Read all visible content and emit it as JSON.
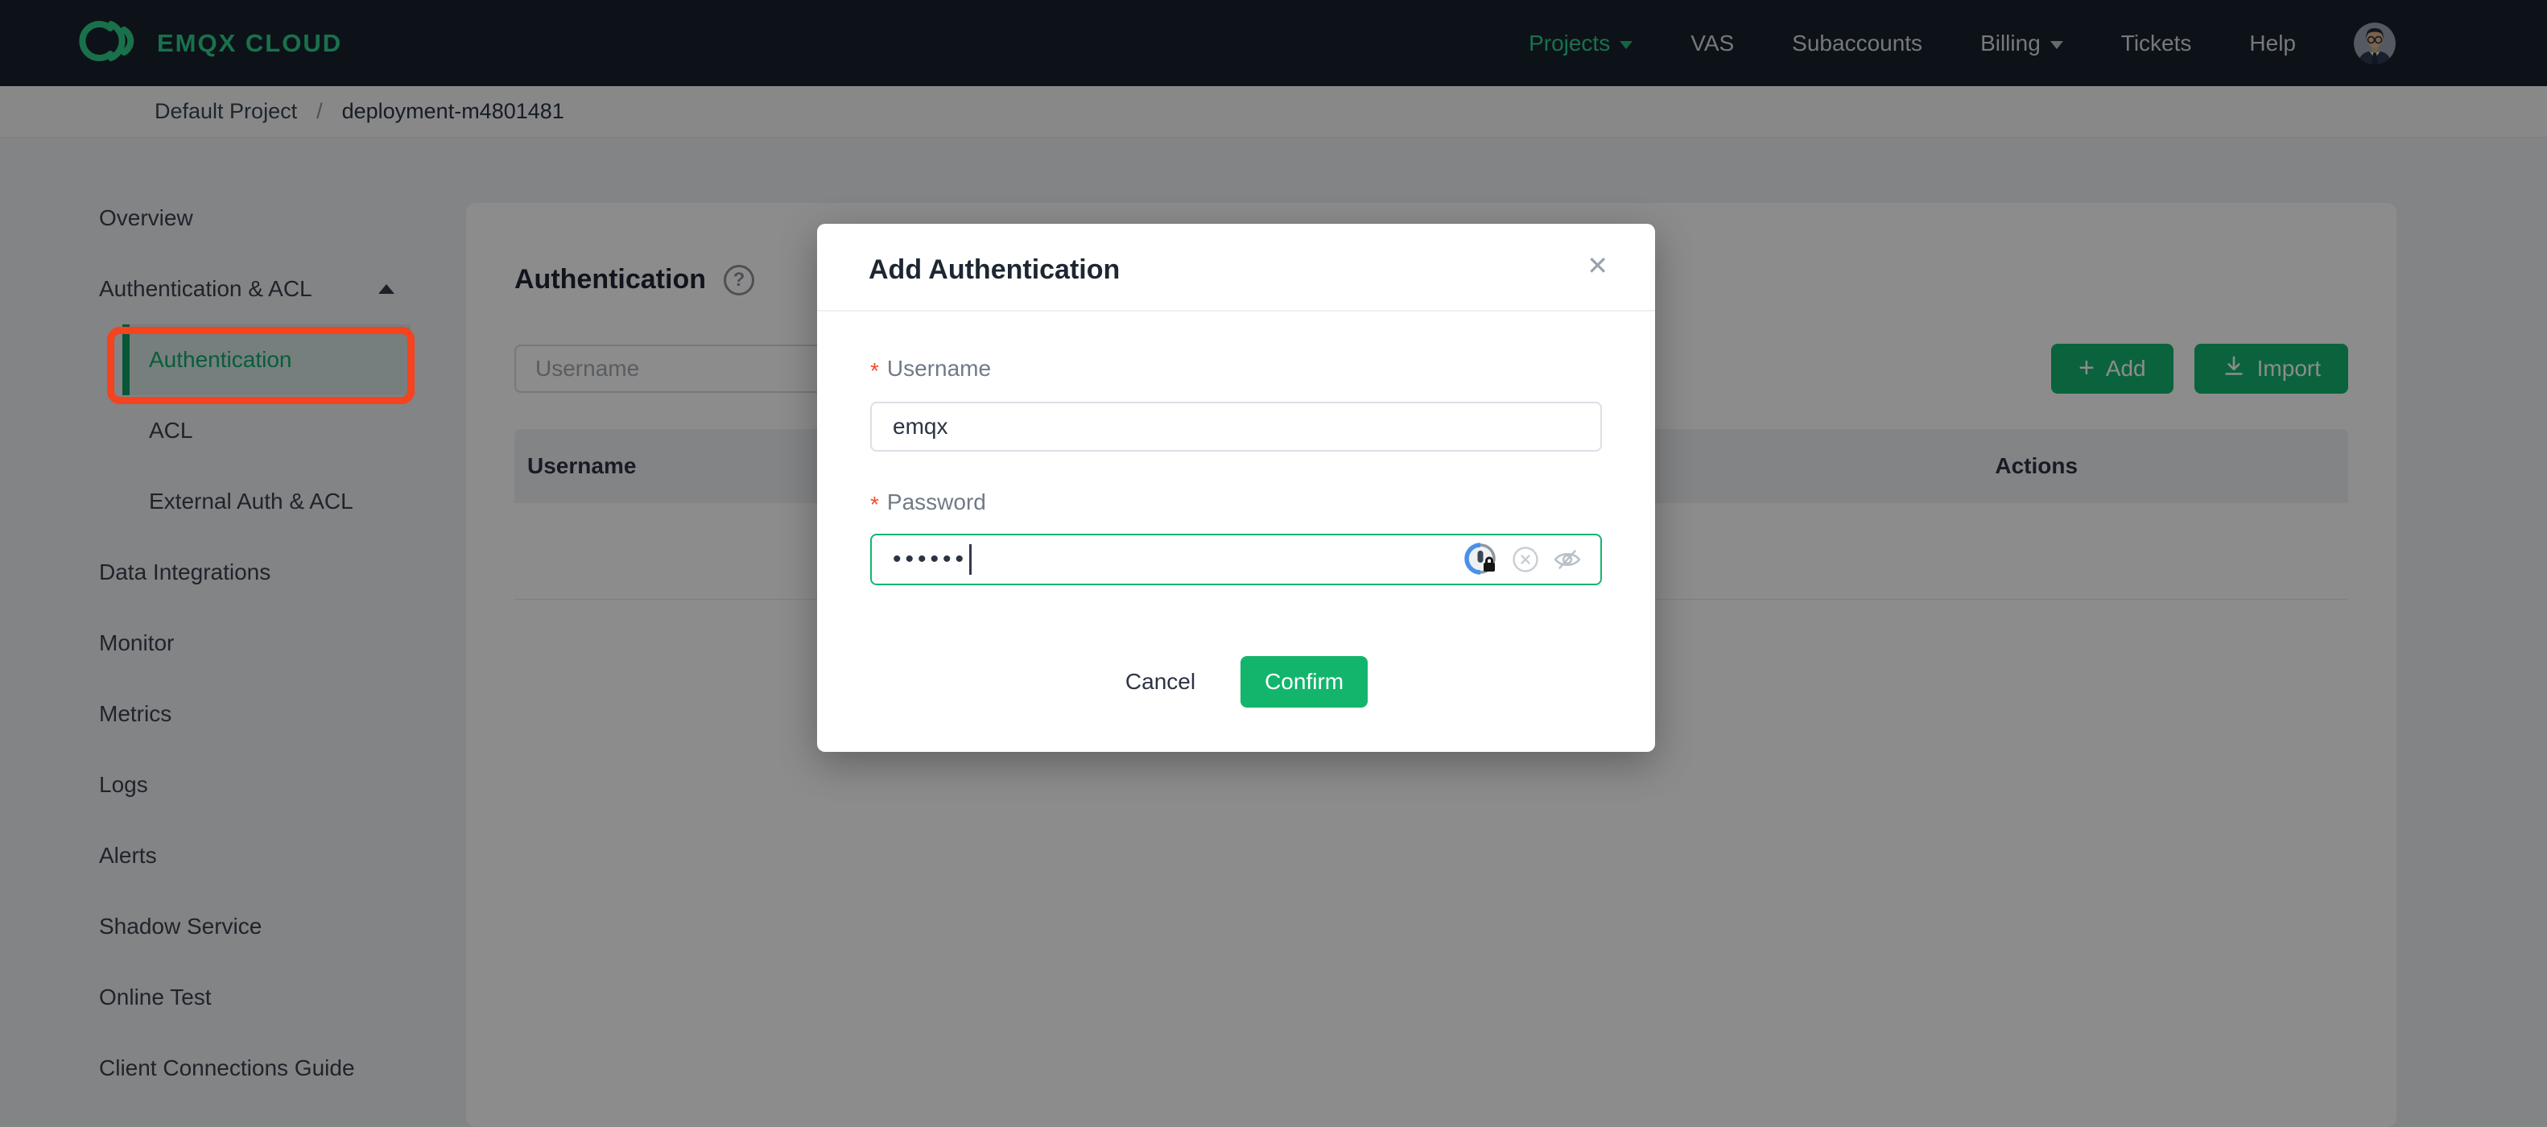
{
  "topbar": {
    "brand": "EMQX CLOUD",
    "items": [
      {
        "label": "Projects",
        "has_caret": true,
        "active": true
      },
      {
        "label": "VAS"
      },
      {
        "label": "Subaccounts"
      },
      {
        "label": "Billing",
        "has_caret": true
      },
      {
        "label": "Tickets"
      },
      {
        "label": "Help"
      }
    ]
  },
  "breadcrumb": {
    "project": "Default Project",
    "separator": "/",
    "deployment": "deployment-m4801481"
  },
  "sidebar": {
    "items": [
      {
        "label": "Overview",
        "level": 1
      },
      {
        "label": "Authentication & ACL",
        "level": 1,
        "expanded": true
      },
      {
        "label": "Authentication",
        "level": 2,
        "active": true,
        "annotated": true
      },
      {
        "label": "ACL",
        "level": 2
      },
      {
        "label": "External Auth & ACL",
        "level": 2
      },
      {
        "label": "Data Integrations",
        "level": 1
      },
      {
        "label": "Monitor",
        "level": 1
      },
      {
        "label": "Metrics",
        "level": 1
      },
      {
        "label": "Logs",
        "level": 1
      },
      {
        "label": "Alerts",
        "level": 1
      },
      {
        "label": "Shadow Service",
        "level": 1
      },
      {
        "label": "Online Test",
        "level": 1
      },
      {
        "label": "Client Connections Guide",
        "level": 1
      }
    ]
  },
  "content": {
    "title": "Authentication",
    "help_glyph": "?",
    "search_placeholder": "Username",
    "buttons": {
      "add_icon": "+",
      "add": "Add",
      "import": "Import"
    },
    "table": {
      "columns": [
        "Username",
        "Actions"
      ]
    }
  },
  "modal": {
    "title": "Add Authentication",
    "close_glyph": "✕",
    "required_mark": "*",
    "fields": [
      {
        "label": "Username",
        "required": true,
        "value": "emqx"
      },
      {
        "label": "Password",
        "required": true,
        "masked_value": "••••••"
      }
    ],
    "footer": {
      "cancel": "Cancel",
      "confirm": "Confirm"
    }
  },
  "colors": {
    "accent": "#13b56d",
    "brand": "#2fce8a",
    "annotation": "#f5421f",
    "topbar-bg": "#19212c",
    "page-bg": "#eef0f3",
    "header-band": "#eef0f4",
    "text-dark": "#2b3442",
    "asterisk": "#f5492c",
    "border": "#dcdfe6"
  }
}
